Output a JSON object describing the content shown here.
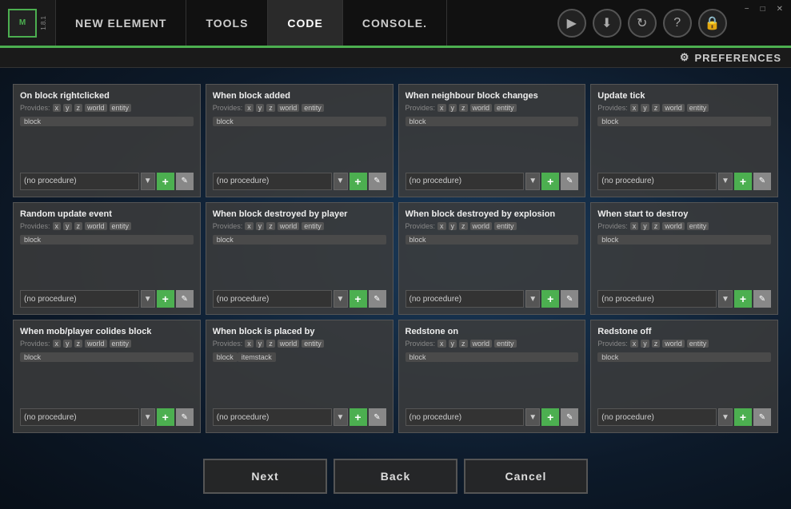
{
  "titlebar": {
    "logo_text": "M",
    "version": "1.8.1",
    "tabs": [
      {
        "label": "NEW ELEMENT",
        "active": false
      },
      {
        "label": "TOOLS",
        "active": false
      },
      {
        "label": "CODE",
        "active": true
      },
      {
        "label": "CONSOLE.",
        "active": false
      }
    ],
    "icons": [
      "▶",
      "⬇",
      "⟳",
      "?",
      "🔒"
    ],
    "window_controls": [
      "−",
      "□",
      "✕"
    ]
  },
  "preferences": {
    "label": "PREFERENCES",
    "icon": "⚙"
  },
  "cards": [
    {
      "id": "on-block-rightclicked",
      "title": "On block rightclicked",
      "provides_label": "Provides:",
      "provides": [
        "x",
        "y",
        "z",
        "world",
        "entity"
      ],
      "block_tag": "block",
      "dropdown_value": "(no procedure)",
      "dropdown_placeholder": "(no procedure)"
    },
    {
      "id": "when-block-added",
      "title": "When block added",
      "provides_label": "Provides:",
      "provides": [
        "x",
        "y",
        "z",
        "world",
        "entity"
      ],
      "block_tag": "block",
      "dropdown_value": "(no procedure)",
      "dropdown_placeholder": "(no procedure)"
    },
    {
      "id": "when-neighbour-block-changes",
      "title": "When neighbour block changes",
      "provides_label": "Provides:",
      "provides": [
        "x",
        "y",
        "z",
        "world",
        "entity"
      ],
      "block_tag": "block",
      "dropdown_value": "(no procedure)",
      "dropdown_placeholder": "(no procedure)"
    },
    {
      "id": "update-tick",
      "title": "Update tick",
      "provides_label": "Provides:",
      "provides": [
        "x",
        "y",
        "z",
        "world",
        "entity"
      ],
      "block_tag": "block",
      "dropdown_value": "(no procedure)",
      "dropdown_placeholder": "(no procedure)"
    },
    {
      "id": "random-update-event",
      "title": "Random update event",
      "provides_label": "Provides:",
      "provides": [
        "x",
        "y",
        "z",
        "world",
        "entity"
      ],
      "block_tag": "block",
      "dropdown_value": "(no procedure)",
      "dropdown_placeholder": "(no procedure)"
    },
    {
      "id": "when-block-destroyed-player",
      "title": "When block destroyed by player",
      "provides_label": "Provides:",
      "provides": [
        "x",
        "y",
        "z",
        "world",
        "entity"
      ],
      "block_tag": "block",
      "dropdown_value": "(no procedure)",
      "dropdown_placeholder": "(no procedure)"
    },
    {
      "id": "when-block-destroyed-explosion",
      "title": "When block destroyed by explosion",
      "provides_label": "Provides:",
      "provides": [
        "x",
        "y",
        "z",
        "world",
        "entity"
      ],
      "block_tag": "block",
      "dropdown_value": "(no procedure)",
      "dropdown_placeholder": "(no procedure)"
    },
    {
      "id": "when-start-to-destroy",
      "title": "When start to destroy",
      "provides_label": "Provides:",
      "provides": [
        "x",
        "y",
        "z",
        "world",
        "entity"
      ],
      "block_tag": "block",
      "dropdown_value": "(no procedure)",
      "dropdown_placeholder": "(no procedure)"
    },
    {
      "id": "when-mob-player-collides",
      "title": "When mob/player colides block",
      "provides_label": "Provides:",
      "provides": [
        "x",
        "y",
        "z",
        "world",
        "entity"
      ],
      "block_tag": "block",
      "dropdown_value": "(no procedure)",
      "dropdown_placeholder": "(no procedure)"
    },
    {
      "id": "when-block-placed-by",
      "title": "When block is placed by",
      "provides_label": "Provides:",
      "provides": [
        "x",
        "y",
        "z",
        "world",
        "entity"
      ],
      "extra_tags": [
        "block",
        "itemstack"
      ],
      "dropdown_value": "(no procedure)",
      "dropdown_placeholder": "(no procedure)"
    },
    {
      "id": "redstone-on",
      "title": "Redstone on",
      "provides_label": "Provides:",
      "provides": [
        "x",
        "y",
        "z",
        "world",
        "entity"
      ],
      "block_tag": "block",
      "dropdown_value": "(no procedure)",
      "dropdown_placeholder": "(no procedure)"
    },
    {
      "id": "redstone-off",
      "title": "Redstone off",
      "provides_label": "Provides:",
      "provides": [
        "x",
        "y",
        "z",
        "world",
        "entity"
      ],
      "block_tag": "block",
      "dropdown_value": "(no procedure)",
      "dropdown_placeholder": "(no procedure)"
    }
  ],
  "buttons": {
    "next": "Next",
    "back": "Back",
    "cancel": "Cancel"
  }
}
